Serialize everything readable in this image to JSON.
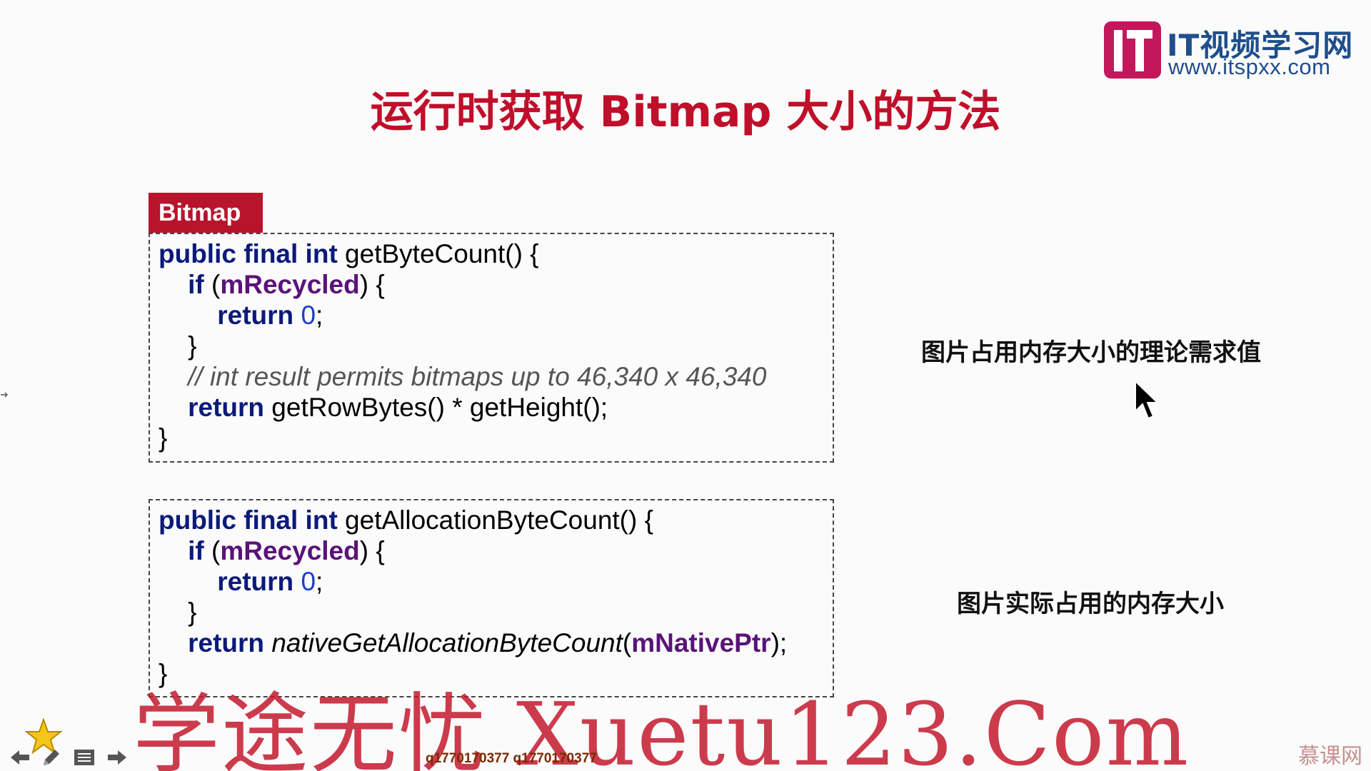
{
  "logo": {
    "title": "IT视频学习网",
    "url": "www.itspxx.com",
    "brand_color": "#c2185b"
  },
  "slide": {
    "title": "运行时获取 Bitmap 大小的方法",
    "class_tag": "Bitmap",
    "block1": {
      "lines": [
        [
          {
            "t": "public final int",
            "c": "kw"
          },
          {
            "t": " getByteCount() {",
            "c": ""
          }
        ],
        [
          {
            "t": "    ",
            "c": ""
          },
          {
            "t": "if",
            "c": "kw"
          },
          {
            "t": " (",
            "c": ""
          },
          {
            "t": "mRecycled",
            "c": "fld"
          },
          {
            "t": ") {",
            "c": ""
          }
        ],
        [
          {
            "t": "        ",
            "c": ""
          },
          {
            "t": "return",
            "c": "kw"
          },
          {
            "t": " ",
            "c": ""
          },
          {
            "t": "0",
            "c": "num"
          },
          {
            "t": ";",
            "c": ""
          }
        ],
        [
          {
            "t": "    }",
            "c": ""
          }
        ],
        [
          {
            "t": "    // int result permits bitmaps up to 46,340 x 46,340",
            "c": "cmt"
          }
        ],
        [
          {
            "t": "    ",
            "c": ""
          },
          {
            "t": "return",
            "c": "kw"
          },
          {
            "t": " getRowBytes() * getHeight();",
            "c": ""
          }
        ],
        [
          {
            "t": "}",
            "c": ""
          }
        ]
      ]
    },
    "block2": {
      "lines": [
        [
          {
            "t": "public final int",
            "c": "kw"
          },
          {
            "t": " getAllocationByteCount() {",
            "c": ""
          }
        ],
        [
          {
            "t": "    ",
            "c": ""
          },
          {
            "t": "if",
            "c": "kw"
          },
          {
            "t": " (",
            "c": ""
          },
          {
            "t": "mRecycled",
            "c": "fld"
          },
          {
            "t": ") {",
            "c": ""
          }
        ],
        [
          {
            "t": "        ",
            "c": ""
          },
          {
            "t": "return",
            "c": "kw"
          },
          {
            "t": " ",
            "c": ""
          },
          {
            "t": "0",
            "c": "num"
          },
          {
            "t": ";",
            "c": ""
          }
        ],
        [
          {
            "t": "    }",
            "c": ""
          }
        ],
        [
          {
            "t": "    ",
            "c": ""
          },
          {
            "t": "return",
            "c": "kw"
          },
          {
            "t": " ",
            "c": ""
          },
          {
            "t": "nativeGetAllocationByteCount",
            "c": "itl"
          },
          {
            "t": "(",
            "c": ""
          },
          {
            "t": "mNativePtr",
            "c": "fld"
          },
          {
            "t": ");",
            "c": ""
          }
        ],
        [
          {
            "t": "}",
            "c": ""
          }
        ]
      ]
    },
    "note1": "图片占用内存大小的理论需求值",
    "note2": "图片实际占用的内存大小"
  },
  "overlay": {
    "watermark": "学途无忧 Xuetu123.Com",
    "qq_text": "q1770170377 q1770170377",
    "brand_bottom": "慕课网"
  },
  "nav": {
    "icons": [
      "star-icon",
      "arrow-left-icon",
      "pen-icon",
      "menu-icon",
      "arrow-right-icon"
    ]
  }
}
